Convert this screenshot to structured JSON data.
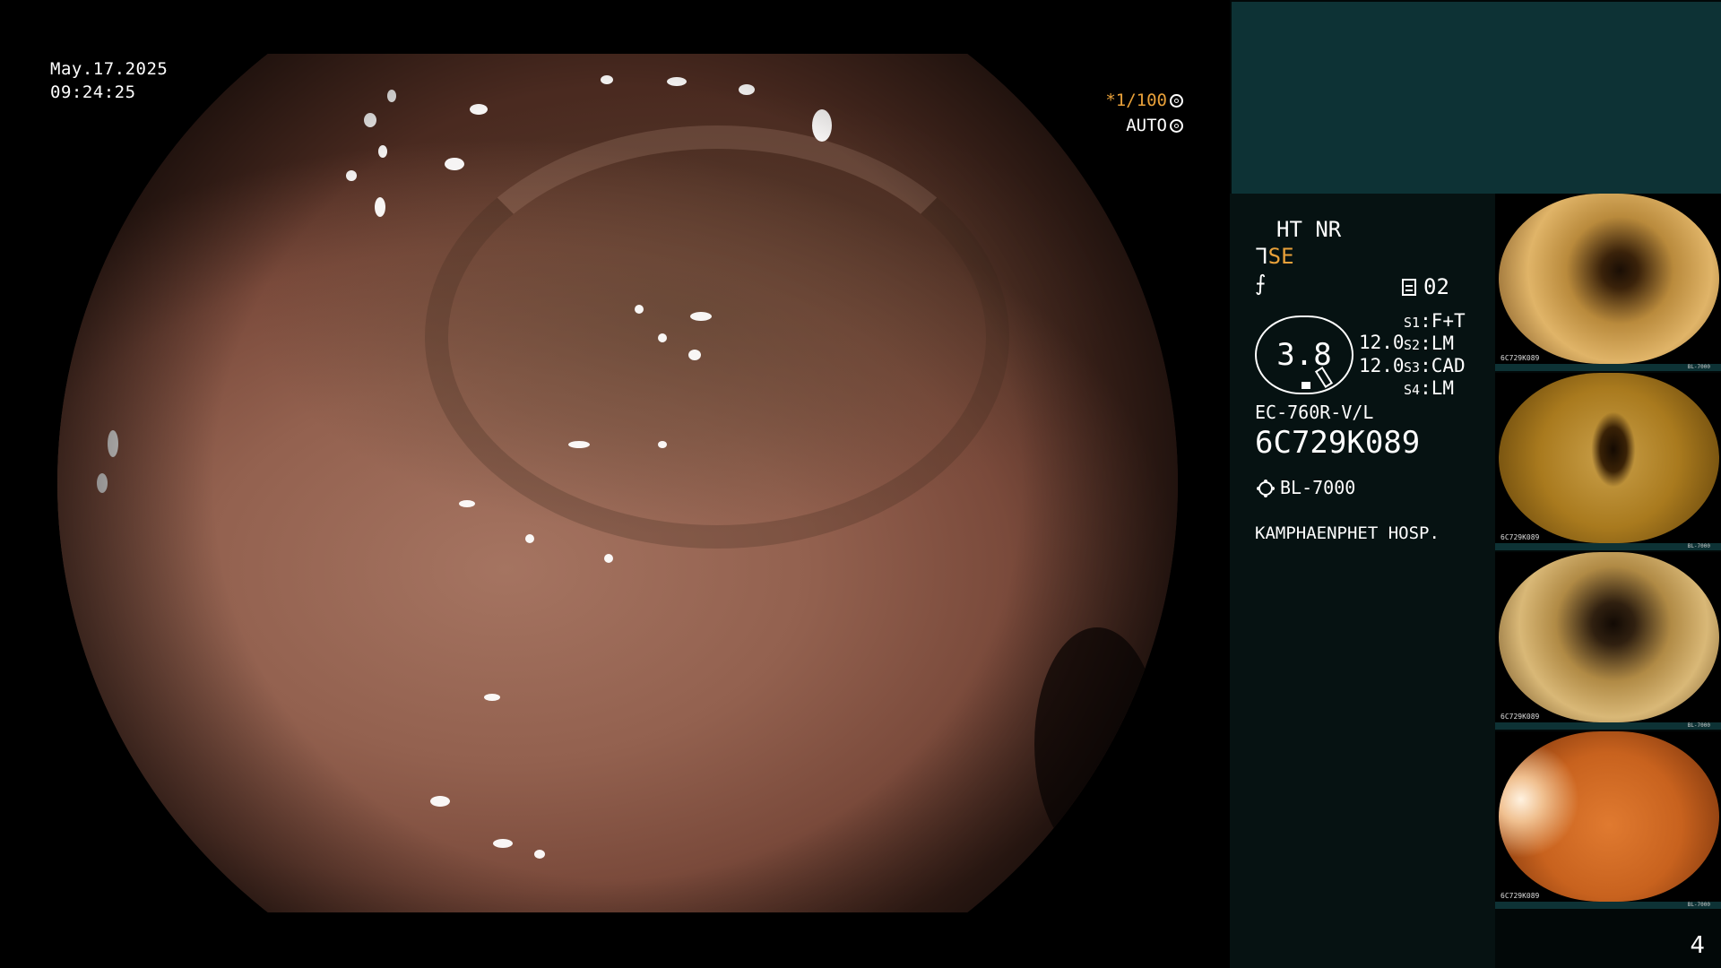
{
  "overlay": {
    "date": "May.17.2025",
    "time": "09:24:25",
    "shutter": "*1/100",
    "mode": "AUTO"
  },
  "panel": {
    "ht_nr": "HT NR",
    "se_label": "SE",
    "memo_number": "02",
    "gauge_value": "3.8",
    "value_a": "12.0",
    "value_b": "12.0",
    "switches": [
      {
        "key": "S1",
        "value": "F+T"
      },
      {
        "key": "S2",
        "value": "LM"
      },
      {
        "key": "S3",
        "value": "CAD"
      },
      {
        "key": "S4",
        "value": "LM"
      }
    ],
    "scope_model": "EC-760R-V/L",
    "scope_serial": "6C729K089",
    "light_source": "BL-7000",
    "hospital": "KAMPHAENPHET HOSP."
  },
  "thumbnails": [
    {
      "caption": "6C729K089",
      "bar_label": "BL-7000",
      "color": "#b98a3c"
    },
    {
      "caption": "6C729K089",
      "bar_label": "BL-7000",
      "color": "#a97a1e"
    },
    {
      "caption": "6C729K089",
      "bar_label": "BL-7000",
      "color": "#b08a45"
    },
    {
      "caption": "6C729K089",
      "bar_label": "BL-7000",
      "color": "#c8621e"
    }
  ],
  "page_number": "4",
  "icons": {
    "shutter": "aperture-icon",
    "mode": "aperture-icon",
    "structure_enhance": "curve-icon",
    "noise": "slash-icon",
    "memo": "memo-icon",
    "light": "sun-icon"
  }
}
